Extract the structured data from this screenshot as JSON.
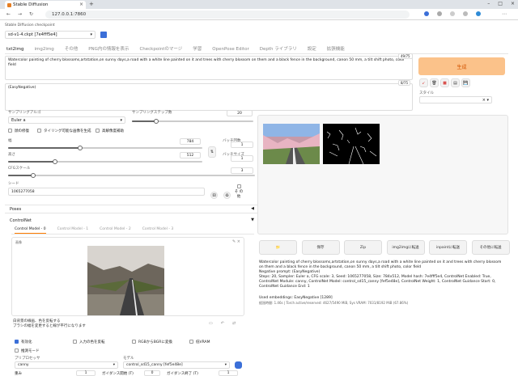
{
  "browser": {
    "tab_title": "Stable Diffusion",
    "url": "127.0.0.1:7860"
  },
  "app": {
    "checkpoint_label": "Stable Diffusion checkpoint",
    "checkpoint_value": "sd-v1-4.ckpt [7e4fff5e4]",
    "tabs": [
      "txt2img",
      "img2img",
      "その他",
      "PNG内の情報を表示",
      "Checkpointのマージ",
      "学習",
      "OpenPose Editor",
      "Depth ライブラリ",
      "設定",
      "拡張機能"
    ],
    "prompt": "Watercolor painting of cherry blossoms,artstation,on sunny days,a road with a white line painted on it and trees with cherry blossom on them and a black fence in the background, canon 50 mm, a tilt shift photo, color field",
    "prompt_count": "49/75",
    "negative_prompt": "(EasyNegative)",
    "negative_count": "8/75",
    "generate_label": "生成",
    "style_label": "スタイル",
    "sampler_label": "サンプリングアルゴ",
    "sampler_value": "Euler a",
    "steps_label": "サンプリングステップ数",
    "steps_value": "20",
    "steps_fraction": 0.2,
    "restore_faces": "顔の修復",
    "tiling": "タイリング可能な画像を生成",
    "hires_fix": "高解像度補助",
    "width_label": "幅",
    "width_value": "784",
    "width_fraction": 0.37,
    "height_label": "高さ",
    "height_value": "512",
    "height_fraction": 0.24,
    "batch_count_label": "バッチ回数",
    "batch_count_value": "1",
    "batch_size_label": "バッチサイズ",
    "batch_size_value": "1",
    "cfg_label": "CFGスケール",
    "cfg_value": "3",
    "cfg_fraction": 0.1,
    "seed_label": "シード",
    "seed_value": "1065277058",
    "extra_label": "そ の 他",
    "poses_label": "Poses",
    "controlnet_label": "ControlNet",
    "cn_tabs": [
      "Control Model - 0",
      "Control Model - 1",
      "Control Model - 2",
      "Control Model - 3"
    ],
    "cn_image_label": "画像",
    "cn_hint_text": "白背景の線画、色を反転する",
    "cn_hint_text2": "ブラシの幅を変更すると線が平行になります",
    "cn_enable": "有効化",
    "cn_invert": "入力の色を反転",
    "cn_rgb_bgr": "RGBからBGRに変換",
    "cn_low_vram": "低VRAM",
    "cn_guess_mode": "推測モード",
    "preprocessor_label": "プリプロセッサ",
    "preprocessor_value": "canny",
    "model_label": "モデル",
    "model_value": "control_sd15_canny [fef5e48e]",
    "bottom_labels": [
      "重み",
      "ガイダンス開始 (T)",
      "ガイダンス終了 (T)"
    ],
    "bottom_values": [
      "1",
      "0",
      "1"
    ],
    "out_buttons": [
      "📁",
      "保存",
      "Zip",
      "img2imgに転送",
      "inpaintに転送",
      "その他に転送"
    ],
    "info_prompt": "Watercolor painting of cherry blossoms,artstation,on sunny days,a road with a white line painted on it and trees with cherry blossom on them and a black fence in the background, canon 50 mm, a tilt shift photo, color field",
    "info_negative": "Negative prompt: (EasyNegative)",
    "info_params": "Steps: 20, Sampler: Euler a, CFG scale: 3, Seed: 1065277058, Size: 784x512, Model hash: 7e4fff5e4, ControlNet Enabled: True, ControlNet Module: canny, ControlNet Model: control_sd15_canny [fef5e48e], ControlNet Weight: 1, ControlNet Guidance Start: 0, ControlNet Guidance End: 1",
    "info_embeddings": "Used embeddings: EasyNegative [1289]",
    "info_time": "経過時間: 1.46s | Torch active/reserved: 4627/5490 MiB, Sys VRAM: 7031/8192 MiB (67.86%)"
  },
  "colors": {
    "accent": "#ff7c00",
    "generate_bg": "#fbc28a",
    "blue": "#3b6fd8"
  }
}
